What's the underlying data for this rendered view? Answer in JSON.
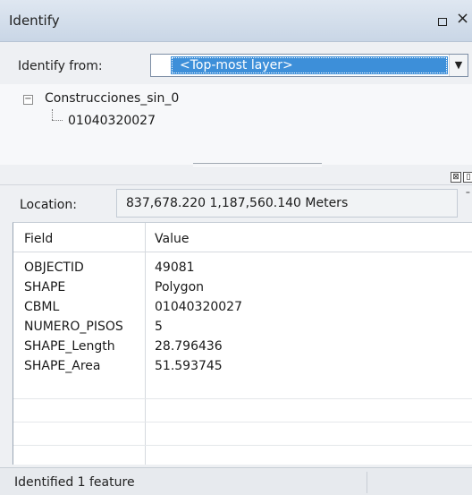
{
  "window": {
    "title": "Identify"
  },
  "identify_from": {
    "label": "Identify from:",
    "selected": "<Top-most layer>"
  },
  "tree": {
    "root": "Construcciones_sin_0",
    "child": "01040320027"
  },
  "location": {
    "label": "Location:",
    "value": "837,678.220  1,187,560.140 Meters"
  },
  "table": {
    "headers": {
      "field": "Field",
      "value": "Value"
    },
    "rows": [
      {
        "field": "OBJECTID",
        "value": "49081"
      },
      {
        "field": "SHAPE",
        "value": "Polygon"
      },
      {
        "field": "CBML",
        "value": "01040320027"
      },
      {
        "field": "NUMERO_PISOS",
        "value": "5"
      },
      {
        "field": "SHAPE_Length",
        "value": "28.796436"
      },
      {
        "field": "SHAPE_Area",
        "value": "51.593745"
      }
    ]
  },
  "status": {
    "text": "Identified 1 feature"
  }
}
